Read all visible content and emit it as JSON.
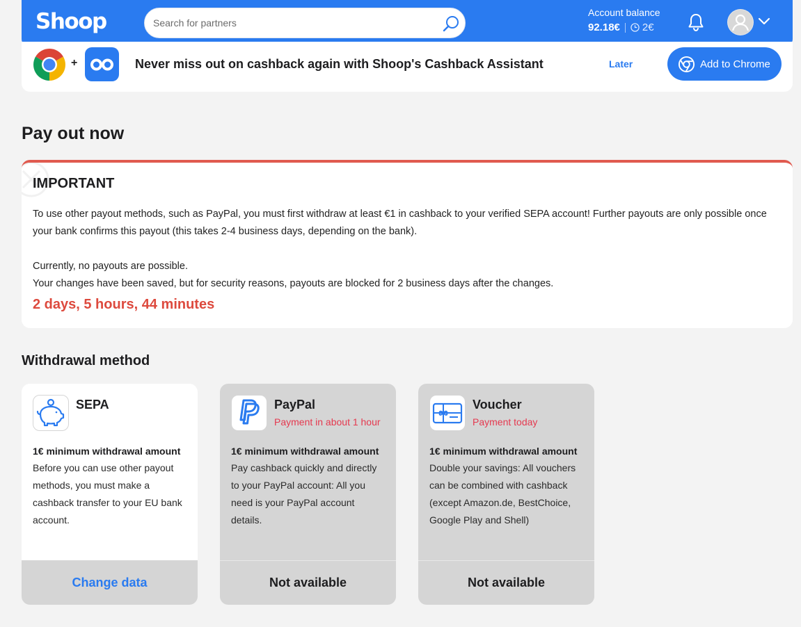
{
  "header": {
    "logo": "Shoop",
    "search_placeholder": "Search for partners",
    "balance_label": "Account balance",
    "balance_value": "92.18€",
    "balance_pending": "2€"
  },
  "banner": {
    "plus": "+",
    "text": "Never miss out on cashback again with Shoop's Cashback Assistant",
    "later": "Later",
    "add_button": "Add to Chrome"
  },
  "page_title": "Pay out now",
  "important": {
    "title": "IMPORTANT",
    "paragraph1": "To use other payout methods, such as PayPal, you must first withdraw at least €1 in cashback to your verified SEPA account! Further payouts are only possible once your bank confirms this payout (this takes 2-4 business days, depending on the bank).",
    "paragraph2": "Currently, no payouts are possible.",
    "paragraph3": "Your changes have been saved, but for security reasons, payouts are blocked for 2 business days after the changes.",
    "countdown": "2 days, 5 hours, 44 minutes"
  },
  "withdrawal": {
    "title": "Withdrawal method",
    "methods": [
      {
        "name": "SEPA",
        "subtitle": "",
        "minimum": "1€ minimum withdrawal amount",
        "description": "Before you can use other payout methods, you must make a cashback transfer to your EU bank account.",
        "footer": "Change data",
        "icon": "piggy-bank-icon"
      },
      {
        "name": "PayPal",
        "subtitle": "Payment in about 1 hour",
        "minimum": "1€ minimum withdrawal amount",
        "description": "Pay cashback quickly and directly to your PayPal account: All you need is your PayPal account details.",
        "footer": "Not available",
        "icon": "paypal-icon"
      },
      {
        "name": "Voucher",
        "subtitle": "Payment today",
        "minimum": "1€ minimum withdrawal amount",
        "description": "Double your savings: All vouchers can be combined with cashback (except Amazon.de, BestChoice, Google Play and Shell)",
        "footer": "Not available",
        "icon": "gift-card-icon"
      }
    ]
  },
  "colors": {
    "brand_blue": "#2a7bf0",
    "alert_red": "#dd4a3e",
    "subtitle_red": "#e5394f"
  }
}
